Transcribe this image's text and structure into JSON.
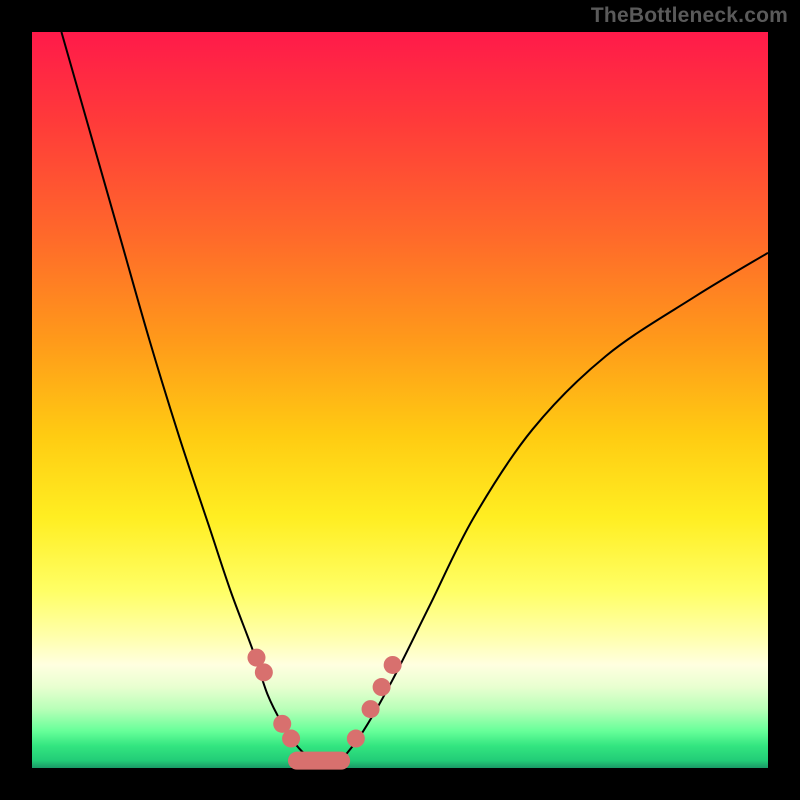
{
  "watermark": "TheBottleneck.com",
  "colors": {
    "background": "#000000",
    "curve": "#000000",
    "marker": "#d8706e"
  },
  "chart_data": {
    "type": "line",
    "title": "",
    "xlabel": "",
    "ylabel": "",
    "xlim": [
      0,
      100
    ],
    "ylim": [
      0,
      100
    ],
    "series": [
      {
        "name": "left-curve",
        "x": [
          4,
          8,
          12,
          16,
          20,
          24,
          27,
          30,
          32,
          34,
          36,
          38
        ],
        "y": [
          100,
          86,
          72,
          58,
          45,
          33,
          24,
          16,
          10,
          6,
          3,
          1
        ]
      },
      {
        "name": "right-curve",
        "x": [
          42,
          45,
          49,
          54,
          60,
          68,
          78,
          90,
          100
        ],
        "y": [
          1,
          5,
          12,
          22,
          34,
          46,
          56,
          64,
          70
        ]
      }
    ],
    "markers": {
      "left_dots_x": [
        30.5,
        31.5,
        34.0,
        35.2
      ],
      "left_dots_y": [
        15,
        13,
        6,
        4
      ],
      "right_dots_x": [
        44.0,
        46.0,
        47.5,
        49.0
      ],
      "right_dots_y": [
        4,
        8,
        11,
        14
      ],
      "bottom_segment_x": [
        36,
        42
      ],
      "bottom_segment_y": [
        1,
        1
      ]
    },
    "background_gradient": {
      "top": "#ff1a4a",
      "mid": "#ffee22",
      "bottom": "#22cc77"
    }
  }
}
